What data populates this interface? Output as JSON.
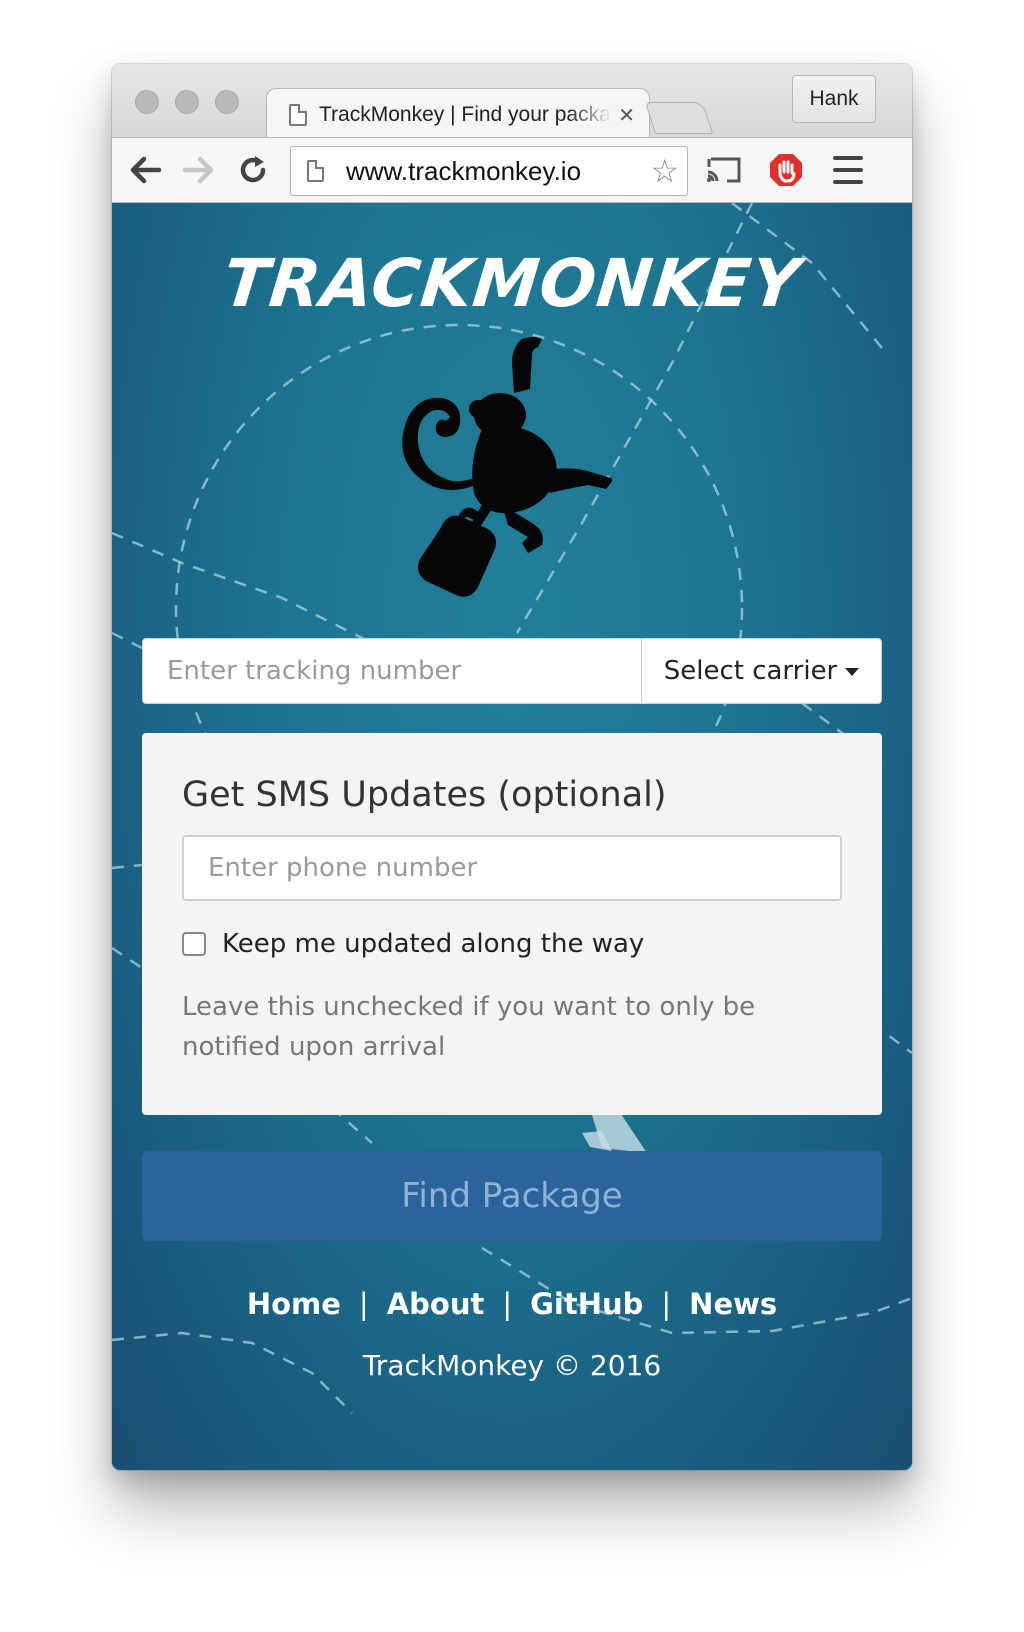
{
  "browser": {
    "tab_title": "TrackMonkey | Find your package",
    "tab_close": "✕",
    "profile_name": "Hank",
    "url": "www.trackmonkey.io"
  },
  "page": {
    "brand": "TRACKMONKEY",
    "tracking_placeholder": "Enter tracking number",
    "carrier_label": "Select carrier",
    "sms": {
      "title": "Get SMS Updates (optional)",
      "phone_placeholder": "Enter phone number",
      "checkbox_label": "Keep me updated along the way",
      "checkbox_checked": false,
      "help": "Leave this unchecked if you want to only be notified upon arrival"
    },
    "find_button": "Find Package",
    "footer": {
      "links": [
        "Home",
        "About",
        "GitHub",
        "News"
      ],
      "separator": "|",
      "copyright": "TrackMonkey © 2016"
    }
  },
  "colors": {
    "page_bg": "#1d7591",
    "button_bg": "#2b649b",
    "button_text": "#8fb3d5",
    "stop_icon": "#e3302a"
  },
  "icons": [
    "back-arrow-icon",
    "forward-arrow-icon",
    "reload-icon",
    "page-icon",
    "star-icon",
    "cast-icon",
    "stop-hand-icon",
    "hamburger-menu-icon",
    "monkey-logo-icon",
    "dropdown-caret-icon"
  ]
}
